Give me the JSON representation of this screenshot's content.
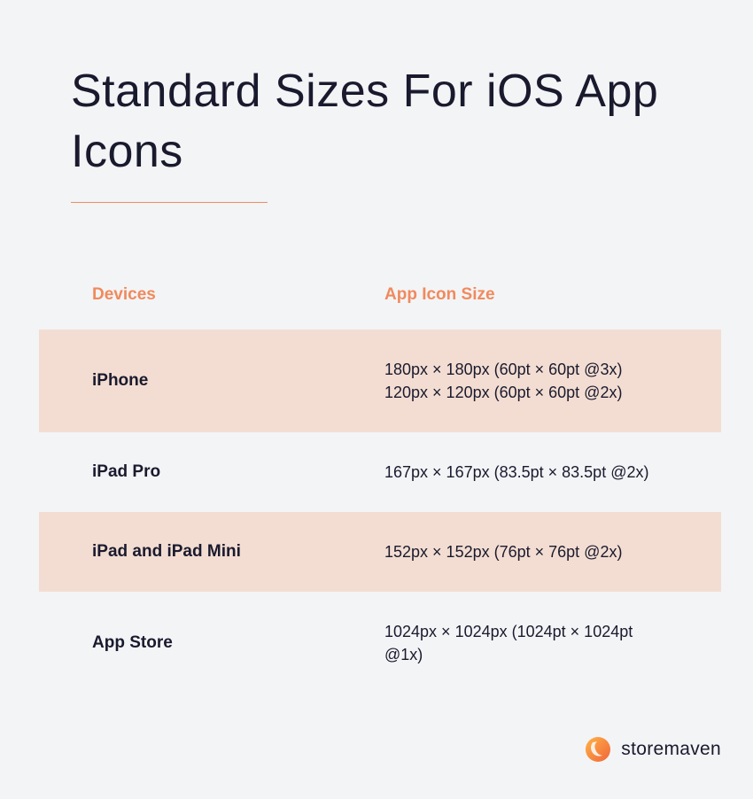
{
  "title": "Standard Sizes For iOS App Icons",
  "headers": {
    "devices": "Devices",
    "size": "App Icon Size"
  },
  "rows": [
    {
      "device": "iPhone",
      "size": "180px × 180px (60pt × 60pt @3x)\n120px × 120px (60pt × 60pt @2x)"
    },
    {
      "device": "iPad Pro",
      "size": "167px × 167px (83.5pt × 83.5pt @2x)"
    },
    {
      "device": "iPad and iPad Mini",
      "size": "152px × 152px (76pt × 76pt @2x)"
    },
    {
      "device": "App Store",
      "size": "1024px × 1024px (1024pt × 1024pt @1x)"
    }
  ],
  "brand": "storemaven",
  "accent_color": "#f08a5d",
  "row_highlight_color": "#f3ddd2"
}
